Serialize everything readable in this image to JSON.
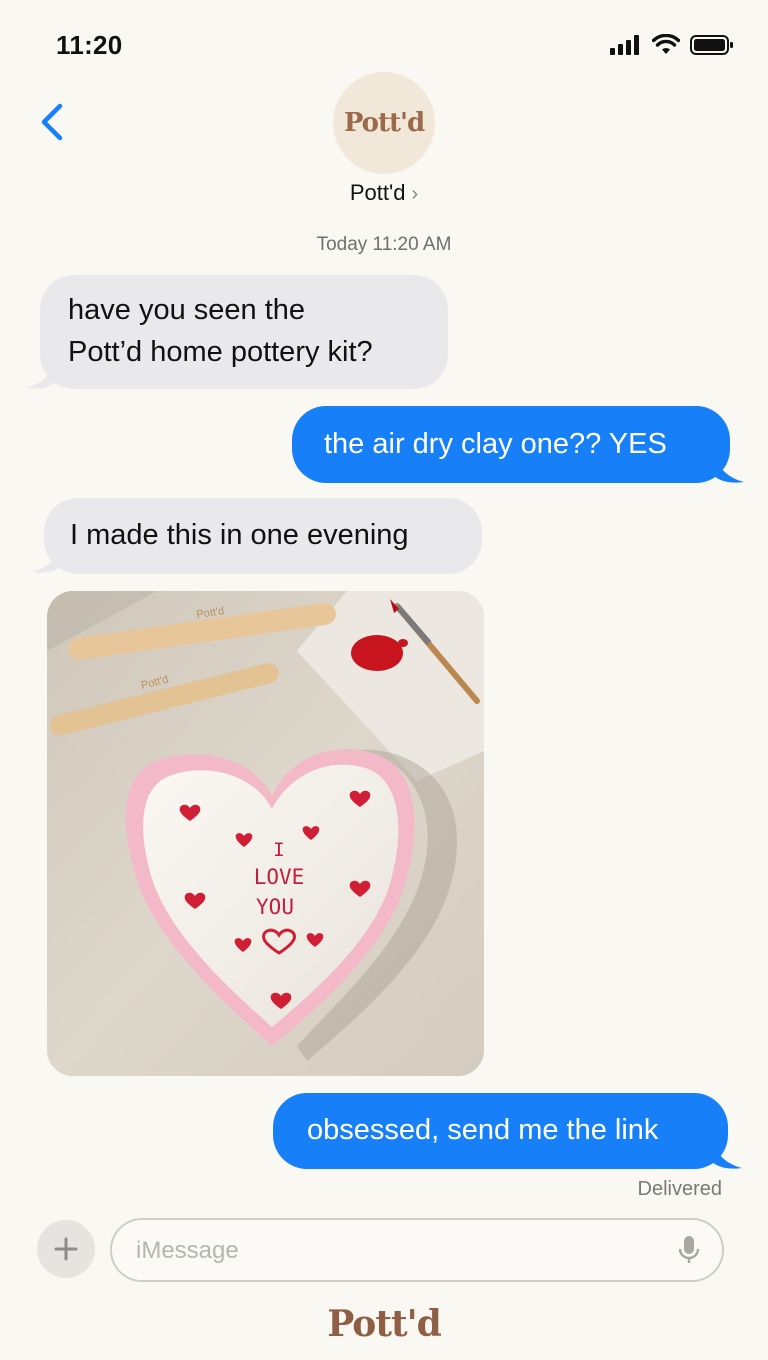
{
  "status": {
    "time": "11:20"
  },
  "contact": {
    "avatar_text": "Pott'd",
    "name": "Pott'd"
  },
  "thread": {
    "timestamp": "Today 11:20 AM",
    "messages": [
      {
        "dir": "in",
        "text_line1": "have you seen the",
        "text_line2": "Pott’d home pottery kit?"
      },
      {
        "dir": "out",
        "text": "the air dry clay one?? YES"
      },
      {
        "dir": "in",
        "text": "I made this in one evening"
      },
      {
        "dir": "in",
        "type": "photo",
        "photo_text_1": "I",
        "photo_text_2": "LOVE",
        "photo_text_3": "YOU",
        "tool_brand": "Pott'd"
      },
      {
        "dir": "out",
        "text": "obsessed, send me the link"
      }
    ],
    "delivered": "Delivered"
  },
  "composer": {
    "placeholder": "iMessage"
  },
  "footer": {
    "logo_text": "Pott'd"
  },
  "colors": {
    "accent": "#1780F8",
    "incoming": "#E9E9EB",
    "brand": "#9A6A4A",
    "background": "#FAF8F3"
  }
}
